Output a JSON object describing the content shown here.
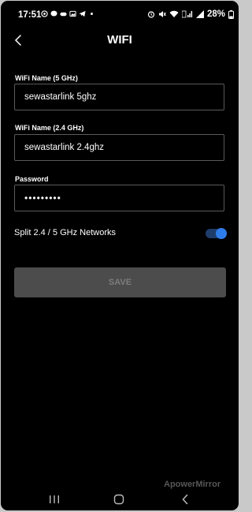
{
  "status_bar": {
    "time": "17:51",
    "battery_percent": "28%"
  },
  "header": {
    "title": "WIFI"
  },
  "form": {
    "wifi5_label": "WiFi Name (5 GHz)",
    "wifi5_value": "sewastarlink 5ghz",
    "wifi24_label": "WiFi Name (2.4 GHz)",
    "wifi24_value": "sewastarlink 2.4ghz",
    "password_label": "Password",
    "password_value": "•••••••••",
    "split_label": "Split 2.4 / 5 GHz Networks",
    "split_enabled": true,
    "save_label": "SAVE"
  },
  "watermark": "ApowerMirror",
  "colors": {
    "background": "#000000",
    "toggle_on": "#2f7dea",
    "save_disabled_bg": "#4c4c4c"
  }
}
